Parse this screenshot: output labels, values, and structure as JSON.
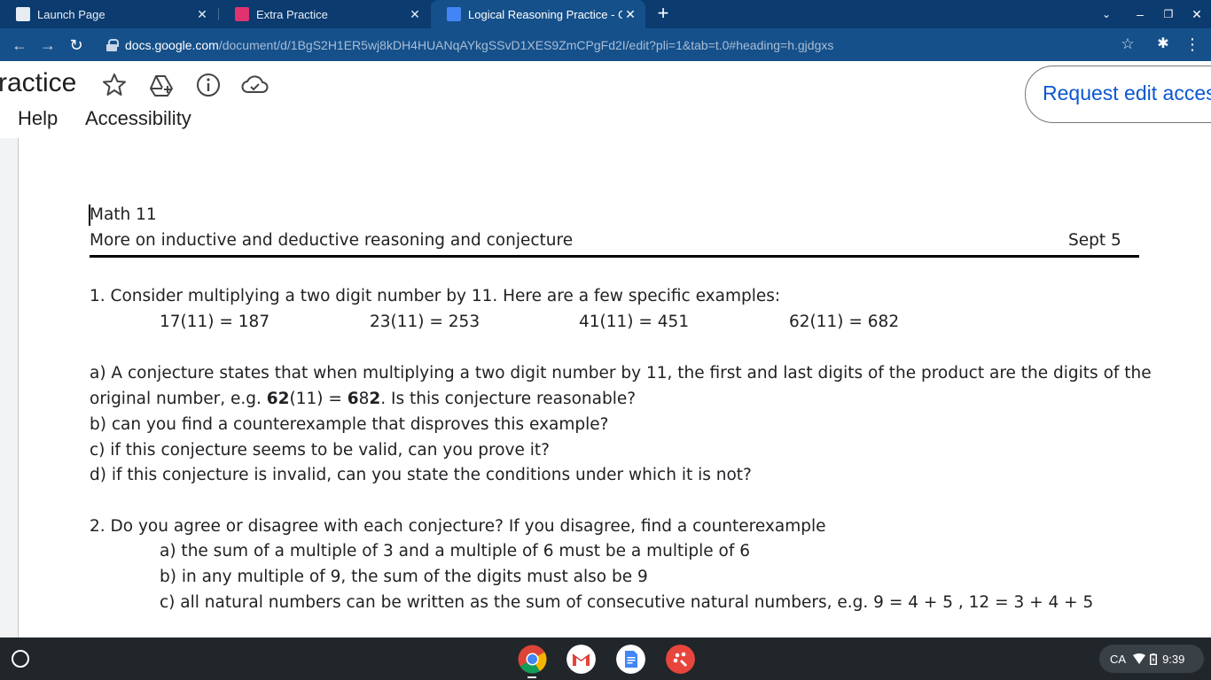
{
  "browser": {
    "tabs": [
      {
        "title": "Launch Page",
        "active": false
      },
      {
        "title": "Extra Practice",
        "active": false
      },
      {
        "title": "Logical Reasoning Practice - Goo",
        "active": true
      }
    ],
    "url_host": "docs.google.com",
    "url_path": "/document/d/1BgS2H1ER5wj8kDH4HUANqAYkgSSvD1XES9ZmCPgFd2I/edit?pli=1&tab=t.0#heading=h.gjdgxs"
  },
  "docs": {
    "title": "ractice",
    "menu": [
      "Help",
      "Accessibility"
    ],
    "request_edit": "Request edit access"
  },
  "document": {
    "course": "Math 11",
    "subtitle": "More on inductive and deductive reasoning and conjecture",
    "date": "Sept 5",
    "q1": "1. Consider multiplying a two digit number by 11.  Here are a few specific examples:",
    "examples": [
      "17(11) = 187",
      "23(11) = 253",
      "41(11) = 451",
      "62(11) = 682"
    ],
    "q1a_line1": "a) A conjecture states that when multiplying a two digit number by 11, the first and last digits of the product are the digits of the",
    "q1a_line2_pre": "original number, e.g. ",
    "q1a_bold1": "62",
    "q1a_mid": "(11) = ",
    "q1a_bold2": "6",
    "q1a_mid2": "8",
    "q1a_bold3": "2",
    "q1a_post": ".  Is this conjecture reasonable?",
    "q1b": "b) can you find a counterexample that disproves this example?",
    "q1c": "c) if this conjecture seems to be valid, can you prove it?",
    "q1d": "d) if this conjecture is invalid, can you state the conditions under which it is not?",
    "q2": "2. Do you agree or disagree with each conjecture?  If you disagree, find a counterexample",
    "q2a": "a) the sum of a multiple of 3 and a multiple of 6 must be a multiple of 6",
    "q2b": "b) in any multiple of 9, the sum of the digits must also be 9",
    "q2c": "c) all natural numbers can be written as the sum of consecutive natural numbers, e.g. 9 = 4 + 5 , 12 = 3 + 4 + 5"
  },
  "shelf": {
    "locale": "CA",
    "time": "9:39"
  },
  "colors": {
    "tabstrip": "#0b3b6f",
    "toolbar": "#15508a",
    "docs_blue": "#0b57d0",
    "shelf": "#20262a"
  }
}
